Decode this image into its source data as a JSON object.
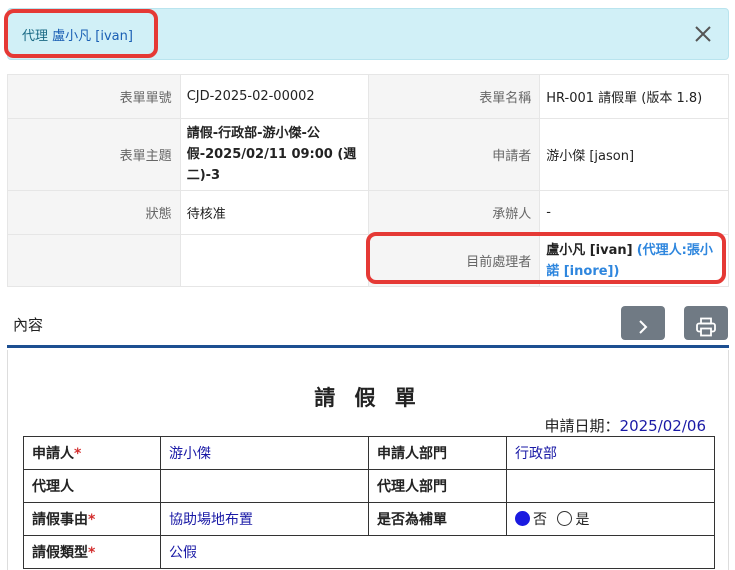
{
  "alert": {
    "prefix": "代理",
    "name": "盧小凡 [ivan]"
  },
  "info": {
    "form_no_label": "表單單號",
    "form_no": "CJD-2025-02-00002",
    "form_name_label": "表單名稱",
    "form_name": "HR-001 請假單 (版本 1.8)",
    "subject_label": "表單主題",
    "subject": "請假-行政部-游小傑-公假-2025/02/11 09:00 (週二)-3",
    "applicant_label": "申請者",
    "applicant": "游小傑 [jason]",
    "status_label": "狀態",
    "status": "待核准",
    "handler_label": "承辦人",
    "handler": "-",
    "current_label": "目前處理者",
    "current_name": "盧小凡 [ivan]",
    "current_proxy": "(代理人:張小諾 [inore])"
  },
  "section": {
    "title": "內容"
  },
  "form": {
    "title": "請 假 單",
    "apply_date_label": "申請日期：",
    "apply_date": "2025/02/06",
    "rows": {
      "applicant_label": "申請人",
      "applicant": "游小傑",
      "dept_label": "申請人部門",
      "dept": "行政部",
      "proxy_label": "代理人",
      "proxy": "",
      "proxy_dept_label": "代理人部門",
      "proxy_dept": "",
      "reason_label": "請假事由",
      "reason": "協助場地布置",
      "makeup_label": "是否為補單",
      "makeup_no": "否",
      "makeup_yes": "是",
      "type_label": "請假類型",
      "type": "公假"
    },
    "required_mark": "*"
  },
  "colors": {
    "highlight": "#e53935",
    "accent": "#1d4f91",
    "status": "#c0392b"
  }
}
